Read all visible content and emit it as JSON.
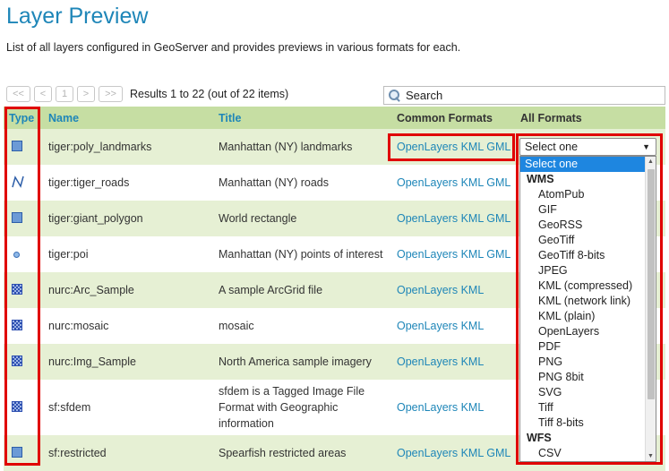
{
  "page": {
    "title": "Layer Preview",
    "description": "List of all layers configured in GeoServer and provides previews in various formats for each."
  },
  "pager": {
    "first": "<<",
    "prev": "<",
    "current": "1",
    "next": ">",
    "last": ">>",
    "status": "Results 1 to 22 (out of 22 items)"
  },
  "search": {
    "label": "Search",
    "icon": "search-icon"
  },
  "table": {
    "headers": {
      "type": "Type",
      "name": "Name",
      "title": "Title",
      "common": "Common Formats",
      "all": "All Formats"
    },
    "rows": [
      {
        "type": "polygon-icon",
        "name": "tiger:poly_landmarks",
        "title": "Manhattan (NY) landmarks",
        "common": "OpenLayers KML GML"
      },
      {
        "type": "line-icon",
        "name": "tiger:tiger_roads",
        "title": "Manhattan (NY) roads",
        "common": "OpenLayers KML GML"
      },
      {
        "type": "polygon-icon",
        "name": "tiger:giant_polygon",
        "title": "World rectangle",
        "common": "OpenLayers KML GML"
      },
      {
        "type": "point-icon",
        "name": "tiger:poi",
        "title": "Manhattan (NY) points of interest",
        "common": "OpenLayers KML GML"
      },
      {
        "type": "raster-icon",
        "name": "nurc:Arc_Sample",
        "title": "A sample ArcGrid file",
        "common": "OpenLayers KML"
      },
      {
        "type": "raster-icon",
        "name": "nurc:mosaic",
        "title": "mosaic",
        "common": "OpenLayers KML"
      },
      {
        "type": "raster-icon",
        "name": "nurc:Img_Sample",
        "title": "North America sample imagery",
        "common": "OpenLayers KML"
      },
      {
        "type": "raster-icon",
        "name": "sf:sfdem",
        "title_lines": [
          "sfdem is a Tagged Image File",
          "Format with Geographic",
          "information"
        ],
        "common": "OpenLayers KML"
      },
      {
        "type": "polygon-icon",
        "name": "sf:restricted",
        "title": "Spearfish restricted areas",
        "common": "OpenLayers KML GML"
      }
    ]
  },
  "all_formats_select": {
    "selected": "Select one",
    "options": [
      {
        "label": "Select one",
        "kind": "selected"
      },
      {
        "label": "WMS",
        "kind": "group"
      },
      {
        "label": "AtomPub",
        "kind": "option"
      },
      {
        "label": "GIF",
        "kind": "option"
      },
      {
        "label": "GeoRSS",
        "kind": "option"
      },
      {
        "label": "GeoTiff",
        "kind": "option"
      },
      {
        "label": "GeoTiff 8-bits",
        "kind": "option"
      },
      {
        "label": "JPEG",
        "kind": "option"
      },
      {
        "label": "KML (compressed)",
        "kind": "option"
      },
      {
        "label": "KML (network link)",
        "kind": "option"
      },
      {
        "label": "KML (plain)",
        "kind": "option"
      },
      {
        "label": "OpenLayers",
        "kind": "option"
      },
      {
        "label": "PDF",
        "kind": "option"
      },
      {
        "label": "PNG",
        "kind": "option"
      },
      {
        "label": "PNG 8bit",
        "kind": "option"
      },
      {
        "label": "SVG",
        "kind": "option"
      },
      {
        "label": "Tiff",
        "kind": "option"
      },
      {
        "label": "Tiff 8-bits",
        "kind": "option"
      },
      {
        "label": "WFS",
        "kind": "group"
      },
      {
        "label": "CSV",
        "kind": "option"
      }
    ]
  },
  "colors": {
    "accent": "#1e86b8",
    "header_bg": "#c6dea3",
    "row_alt": "#e6f0d4",
    "highlight": "#e00000",
    "selected_option": "#1e86e0"
  }
}
